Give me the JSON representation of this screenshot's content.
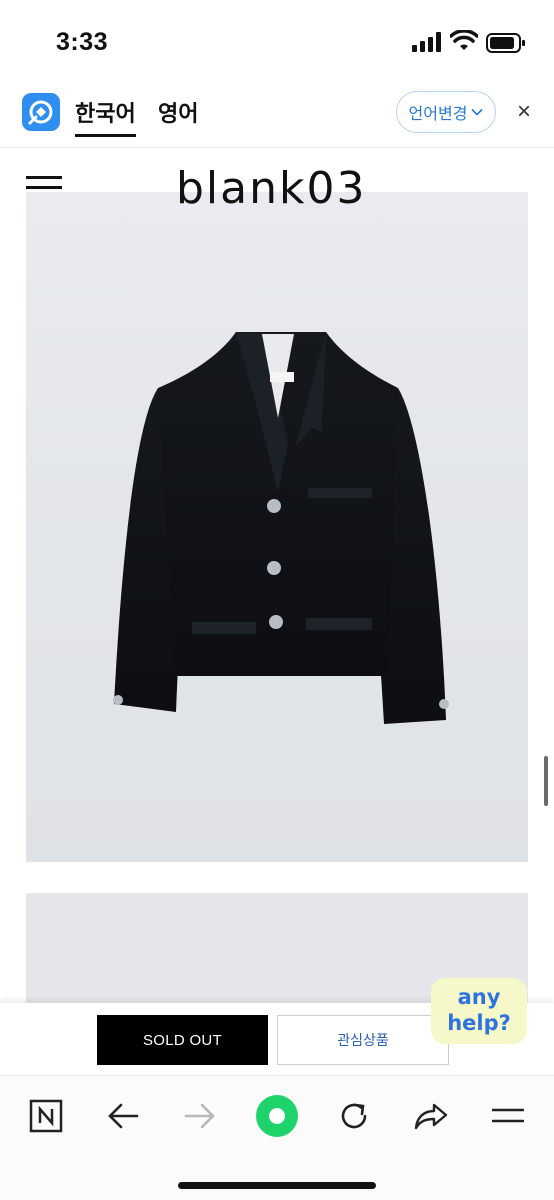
{
  "status": {
    "time": "3:33"
  },
  "translate_bar": {
    "tab_korean": "한국어",
    "tab_english": "영어",
    "change_language": "언어변경",
    "close": "×"
  },
  "site": {
    "brand": "blank03"
  },
  "product": {
    "sold_out_label": "SOLD OUT",
    "wishlist_label": "관심상품"
  },
  "help": {
    "line1": "any",
    "line2": "help?"
  },
  "toolbar": {
    "items": [
      "naver-logo",
      "back-arrow",
      "forward-arrow",
      "home-green",
      "reload",
      "share",
      "menu"
    ]
  },
  "colors": {
    "accent_blue": "#2f8ff0",
    "green": "#1fd36b",
    "help_bg": "#f7f8c9",
    "help_text": "#2f73e0"
  }
}
